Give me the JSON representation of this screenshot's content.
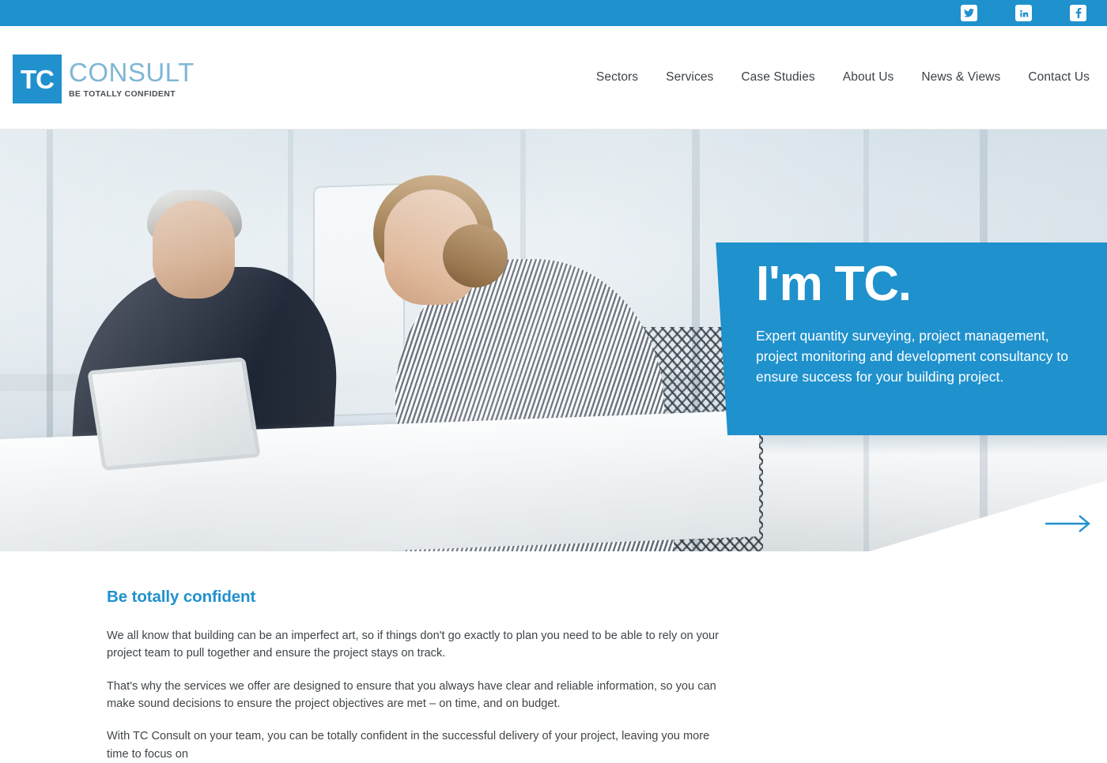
{
  "brand": {
    "accent_color": "#1f91cd",
    "logo_mark": "TC",
    "logo_word": "CONSULT",
    "logo_tagline": "BE TOTALLY CONFIDENT"
  },
  "topbar": {
    "social": [
      {
        "name": "twitter-icon",
        "label": "Twitter"
      },
      {
        "name": "linkedin-icon",
        "label": "LinkedIn"
      },
      {
        "name": "facebook-icon",
        "label": "Facebook"
      }
    ]
  },
  "nav": {
    "items": [
      {
        "label": "Sectors"
      },
      {
        "label": "Services"
      },
      {
        "label": "Case Studies"
      },
      {
        "label": "About Us"
      },
      {
        "label": "News & Views"
      },
      {
        "label": "Contact Us"
      }
    ]
  },
  "hero": {
    "title": "I'm TC.",
    "subtitle": "Expert quantity surveying, project management, project monitoring and development consultancy to ensure success for your building project.",
    "next_arrow_label": "Next slide",
    "banner_color": "#1f91cd"
  },
  "main": {
    "heading": "Be totally confident",
    "heading_color": "#2191ce",
    "paragraphs": [
      "We all know that building can be an imperfect art, so if things don't go exactly to plan you need to be able to rely on your project team to pull together and ensure the project stays on track.",
      "That's why the services we offer are designed to ensure that you always have clear and reliable information, so you can make sound decisions to ensure the project objectives are met – on time, and on budget.",
      "With TC Consult on your team, you can be totally confident in the successful delivery of your project, leaving you more time to focus on"
    ]
  }
}
